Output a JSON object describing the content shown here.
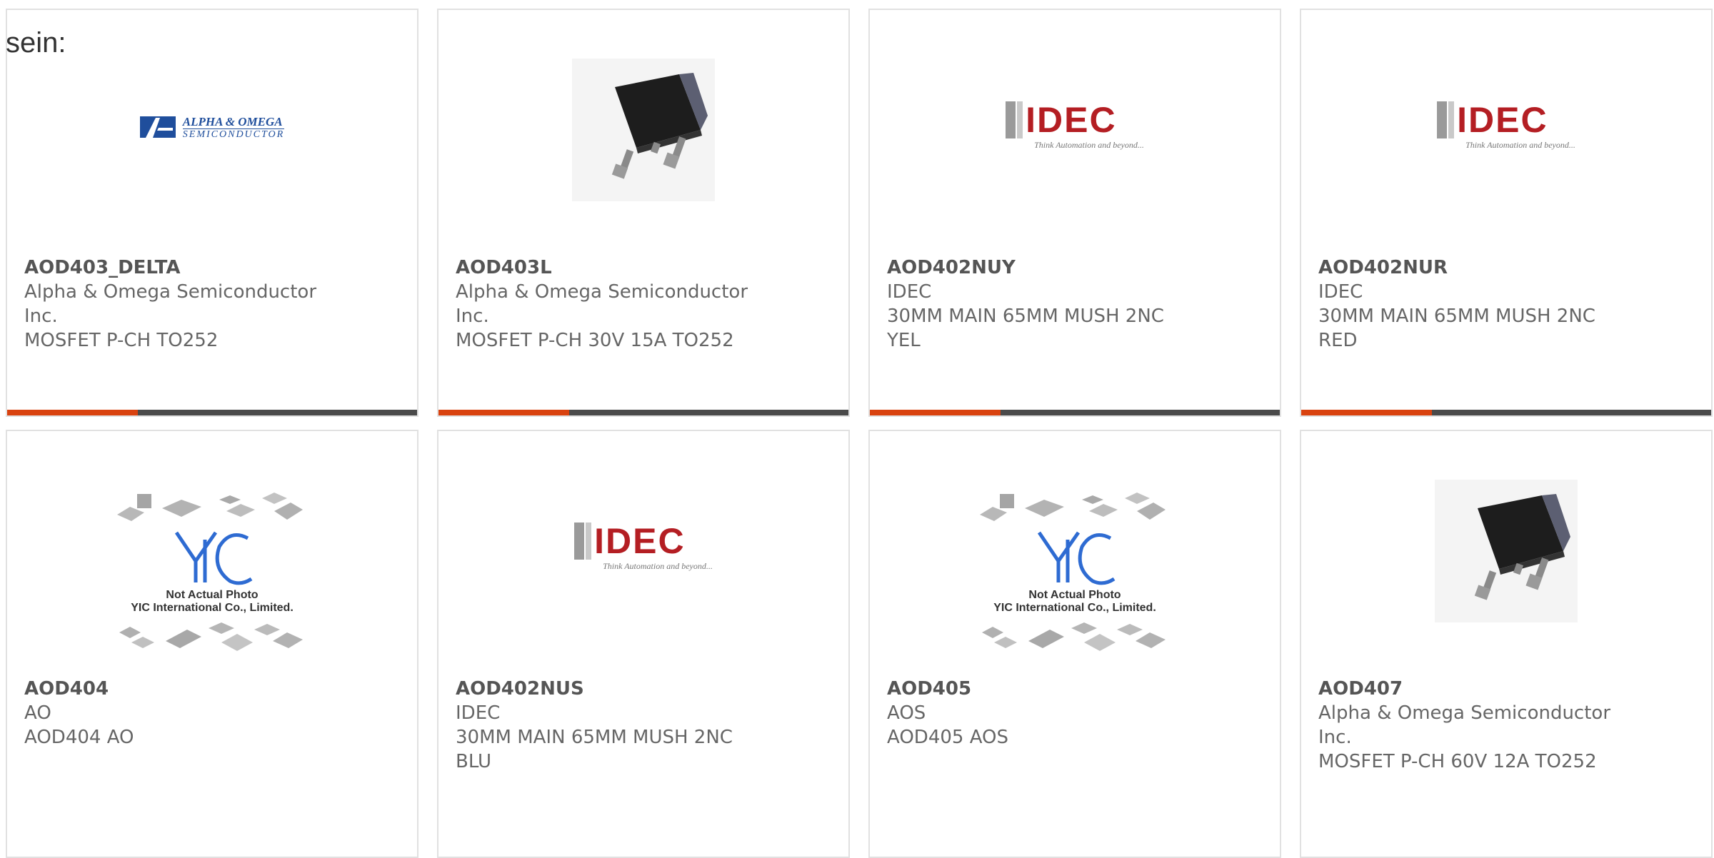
{
  "page": {
    "heading": "sein:"
  },
  "colors": {
    "accent": "#d9420f",
    "bar": "#4a4a4a",
    "idec_red": "#b41e23",
    "ao_blue": "#1f4e9c",
    "yic_blue": "#2e6bd2"
  },
  "products": [
    {
      "part": "AOD403_DELTA",
      "maker_lines": [
        "Alpha & Omega Semiconductor",
        "Inc."
      ],
      "desc_lines": [
        "MOSFET P-CH TO252"
      ],
      "image": "alpha-omega-logo"
    },
    {
      "part": "AOD403L",
      "maker_lines": [
        "Alpha & Omega Semiconductor",
        "Inc."
      ],
      "desc_lines": [
        "MOSFET P-CH 30V 15A TO252"
      ],
      "image": "to252-package-photo"
    },
    {
      "part": "AOD402NUY",
      "maker_lines": [
        "IDEC"
      ],
      "desc_lines": [
        "30MM MAIN 65MM MUSH 2NC",
        "YEL"
      ],
      "image": "idec-logo"
    },
    {
      "part": "AOD402NUR",
      "maker_lines": [
        "IDEC"
      ],
      "desc_lines": [
        "30MM MAIN 65MM MUSH 2NC",
        "RED"
      ],
      "image": "idec-logo"
    },
    {
      "part": "AOD404",
      "maker_lines": [
        "AO"
      ],
      "desc_lines": [
        "AOD404 AO"
      ],
      "image": "yic-not-actual-photo"
    },
    {
      "part": "AOD402NUS",
      "maker_lines": [
        "IDEC"
      ],
      "desc_lines": [
        "30MM MAIN 65MM MUSH 2NC",
        "BLU"
      ],
      "image": "idec-logo"
    },
    {
      "part": "AOD405",
      "maker_lines": [
        "AOS"
      ],
      "desc_lines": [
        "AOD405 AOS"
      ],
      "image": "yic-not-actual-photo"
    },
    {
      "part": "AOD407",
      "maker_lines": [
        "Alpha & Omega Semiconductor",
        "Inc."
      ],
      "desc_lines": [
        "MOSFET P-CH 60V 12A TO252"
      ],
      "image": "to252-package-photo"
    }
  ],
  "logos": {
    "ao_line1": "ALPHA & OMEGA",
    "ao_line2": "SEMICONDUCTOR",
    "idec_text": "IDEC",
    "idec_tagline": "Think Automation and beyond...",
    "yic_line1": "Not Actual Photo",
    "yic_line2": "YIC International Co., Limited."
  }
}
